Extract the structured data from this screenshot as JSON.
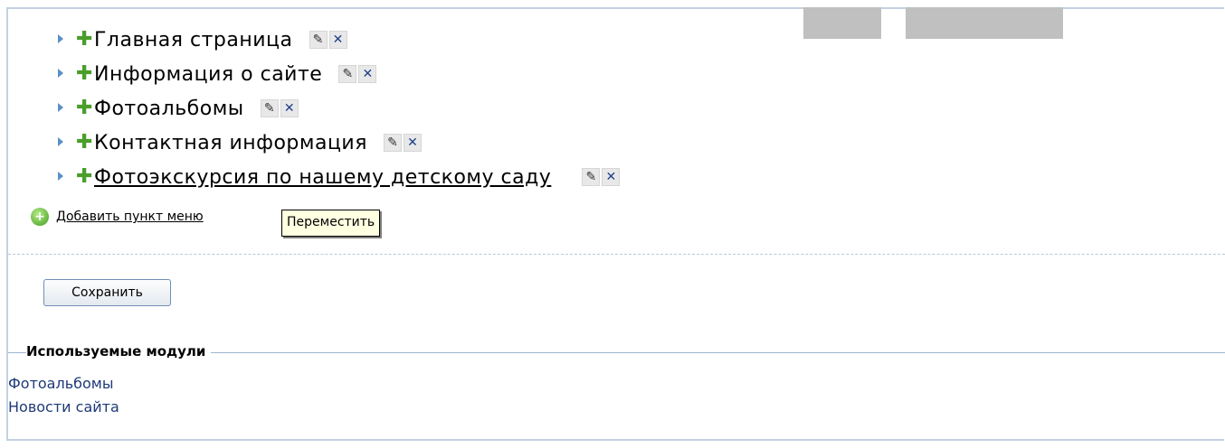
{
  "menu": {
    "items": [
      {
        "label": "Главная страница",
        "edit_icon": "pencil-icon",
        "delete_icon": "x-icon",
        "linked": false
      },
      {
        "label": "Информация о сайте",
        "edit_icon": "pencil-icon",
        "delete_icon": "x-icon",
        "linked": false
      },
      {
        "label": "Фотоальбомы",
        "edit_icon": "pencil-icon",
        "delete_icon": "x-icon",
        "linked": false
      },
      {
        "label": "Контактная информация",
        "edit_icon": "pencil-icon",
        "delete_icon": "x-icon",
        "linked": false
      },
      {
        "label": "Фотоэкскурсия по нашему детскому саду",
        "edit_icon": "pencil-icon",
        "delete_icon": "x-icon",
        "linked": true
      }
    ],
    "add_label": "Добавить пункт меню",
    "tooltip": "Переместить"
  },
  "form": {
    "save_label": "Сохранить"
  },
  "modules": {
    "legend": "Используемые модули",
    "items": [
      "Фотоальбомы",
      "Новости сайта"
    ]
  },
  "colors": {
    "frame_border": "#c3d1e3",
    "plus_green": "#4a9e2a",
    "link_blue": "#1e3a78",
    "tooltip_bg": "#ffffe1",
    "topbar_gray": "#c0c0c0"
  }
}
